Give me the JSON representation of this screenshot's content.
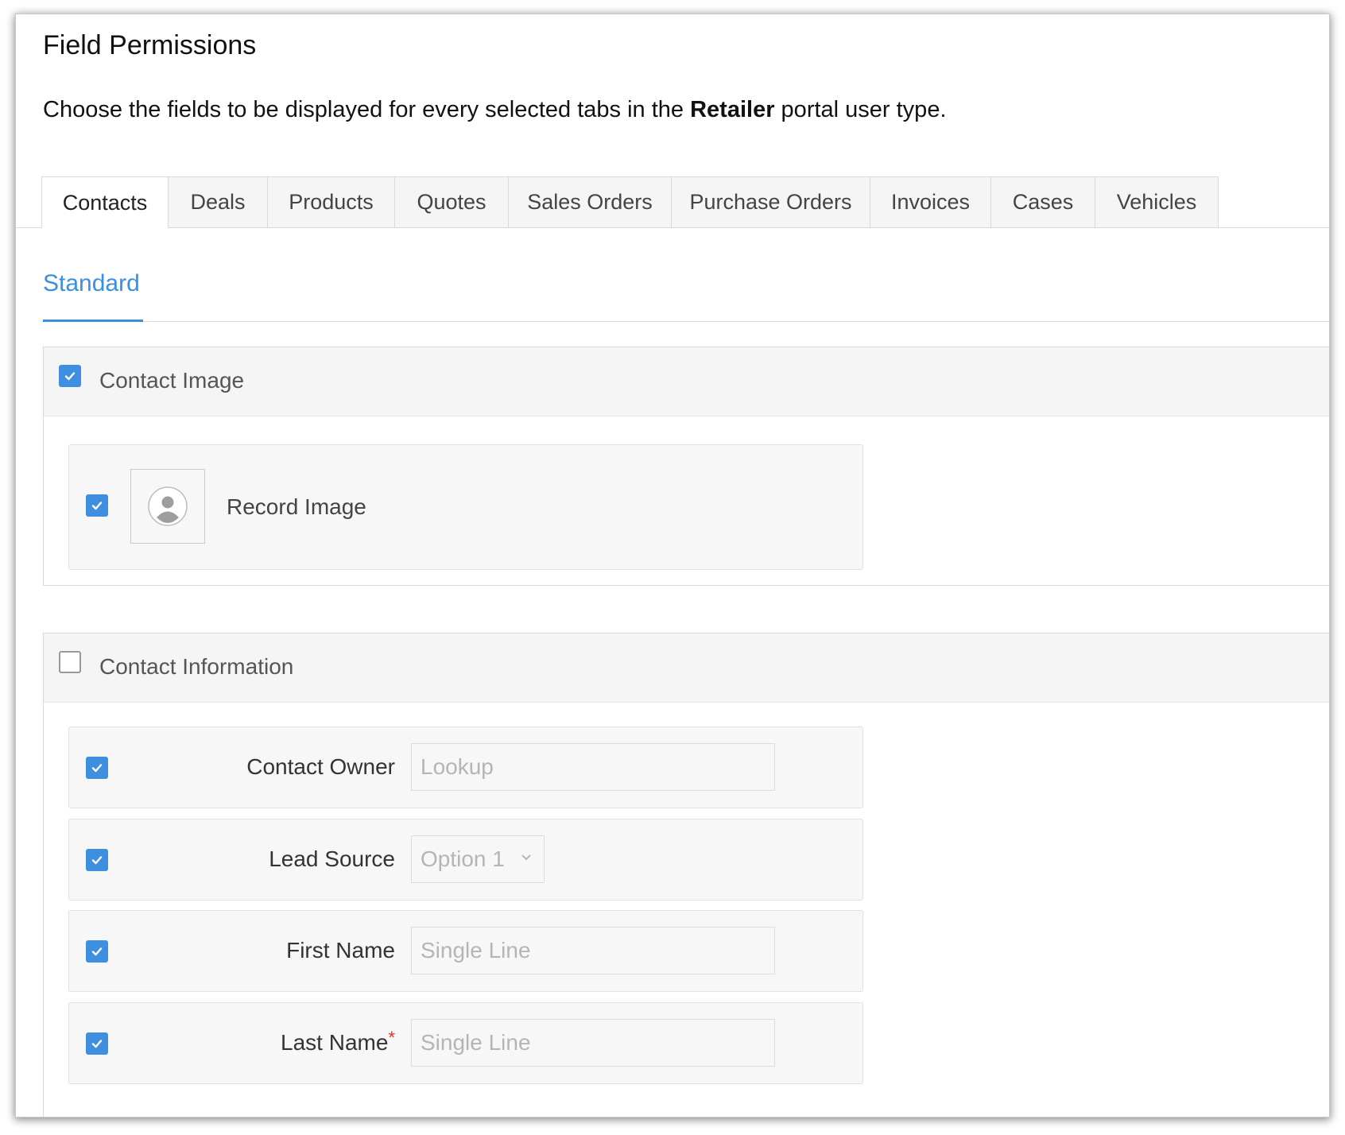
{
  "page": {
    "title": "Field Permissions",
    "subtitle_before": "Choose the fields to be displayed for every selected tabs in the ",
    "subtitle_bold": "Retailer",
    "subtitle_after": " portal user type."
  },
  "tabs": [
    "Contacts",
    "Deals",
    "Products",
    "Quotes",
    "Sales Orders",
    "Purchase Orders",
    "Invoices",
    "Cases",
    "Vehicles"
  ],
  "active_tab": "Contacts",
  "subtab": {
    "label": "Standard"
  },
  "sections": [
    {
      "title": "Contact Image",
      "checked": true,
      "fields": [
        {
          "label": "Record Image",
          "checked": true,
          "icon": "user-avatar-icon"
        }
      ]
    },
    {
      "title": "Contact Information",
      "checked": false,
      "fields": [
        {
          "label": "Contact Owner",
          "checked": true,
          "placeholder": "Lookup",
          "required": false
        },
        {
          "label": "Lead Source",
          "checked": true,
          "placeholder": "Option 1",
          "required": false,
          "type": "select"
        },
        {
          "label": "First Name",
          "checked": true,
          "placeholder": "Single Line",
          "required": false
        },
        {
          "label": "Last Name",
          "checked": true,
          "placeholder": "Single Line",
          "required": true,
          "required_mark": "*"
        }
      ]
    }
  ],
  "colors": {
    "accent": "#3a8fde",
    "checkbox": "#3f8fe1",
    "required": "#d0342c"
  },
  "icons": {
    "check": "check-icon",
    "chevron": "chevron-down-icon",
    "avatar": "user-avatar-icon"
  }
}
